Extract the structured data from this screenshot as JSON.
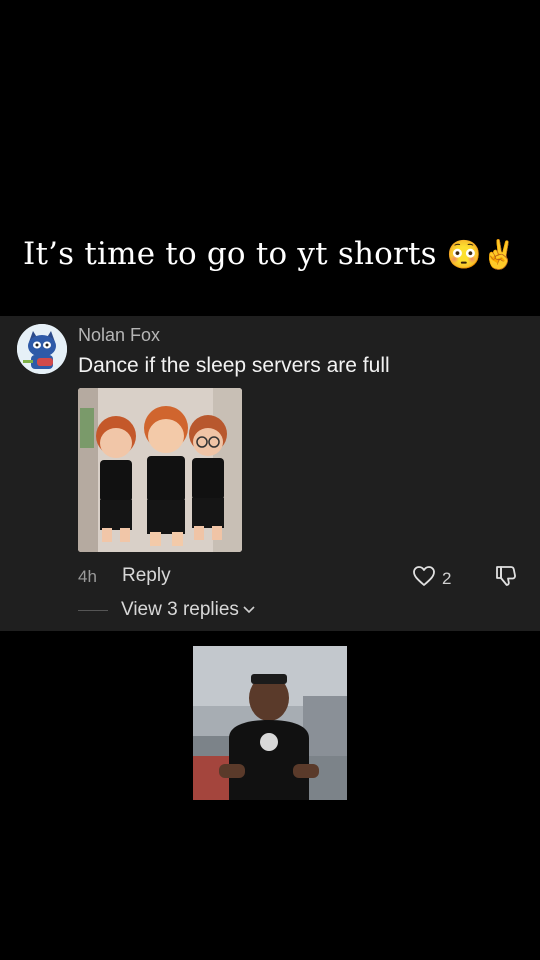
{
  "caption": {
    "text": "It’s time to go to yt shorts",
    "emoji": "😳✌️"
  },
  "comment": {
    "author": "Nolan Fox",
    "text": "Dance if the sleep servers are full",
    "time": "4h",
    "reply_label": "Reply",
    "like_count": "2",
    "view_replies_label": "View 3 replies"
  },
  "icons": {
    "like": "heart-icon",
    "dislike": "thumbs-down-icon",
    "expand": "chevron-down-icon"
  }
}
